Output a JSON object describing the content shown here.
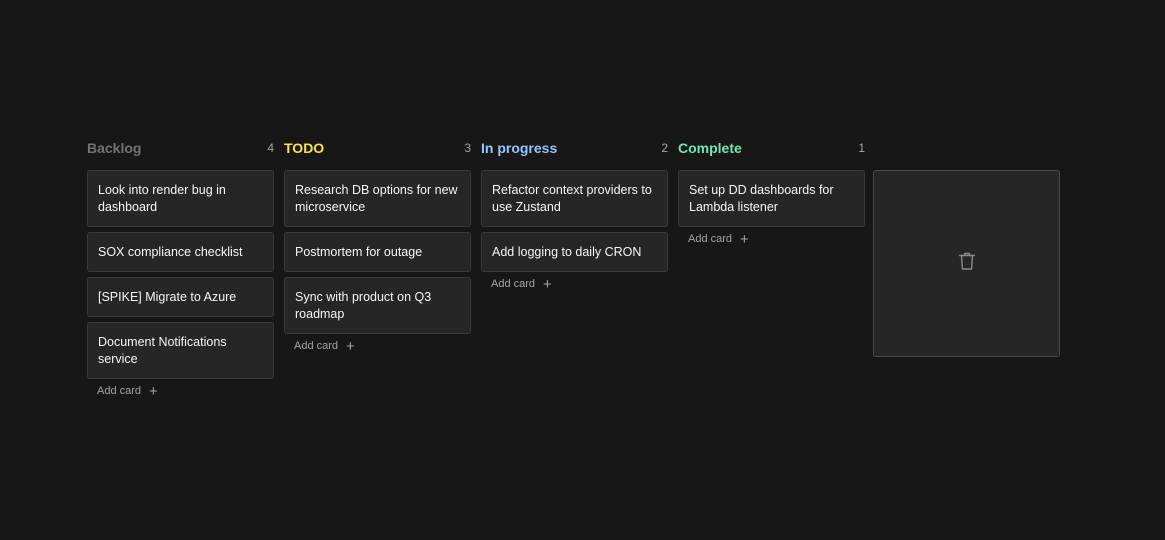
{
  "columns": [
    {
      "title": "Backlog",
      "count": "4",
      "color": "#737373",
      "cards": [
        "Look into render bug in dashboard",
        "SOX compliance checklist",
        "[SPIKE] Migrate to Azure",
        "Document Notifications service"
      ],
      "add_label": "Add card"
    },
    {
      "title": "TODO",
      "count": "3",
      "color": "#fde047",
      "cards": [
        "Research DB options for new microservice",
        "Postmortem for outage",
        "Sync with product on Q3 roadmap"
      ],
      "add_label": "Add card"
    },
    {
      "title": "In progress",
      "count": "2",
      "color": "#93c5fd",
      "cards": [
        "Refactor context providers to use Zustand",
        "Add logging to daily CRON"
      ],
      "add_label": "Add card"
    },
    {
      "title": "Complete",
      "count": "1",
      "color": "#6ee7b7",
      "cards": [
        "Set up DD dashboards for Lambda listener"
      ],
      "add_label": "Add card"
    }
  ],
  "trash": {
    "icon": "trash-icon"
  }
}
